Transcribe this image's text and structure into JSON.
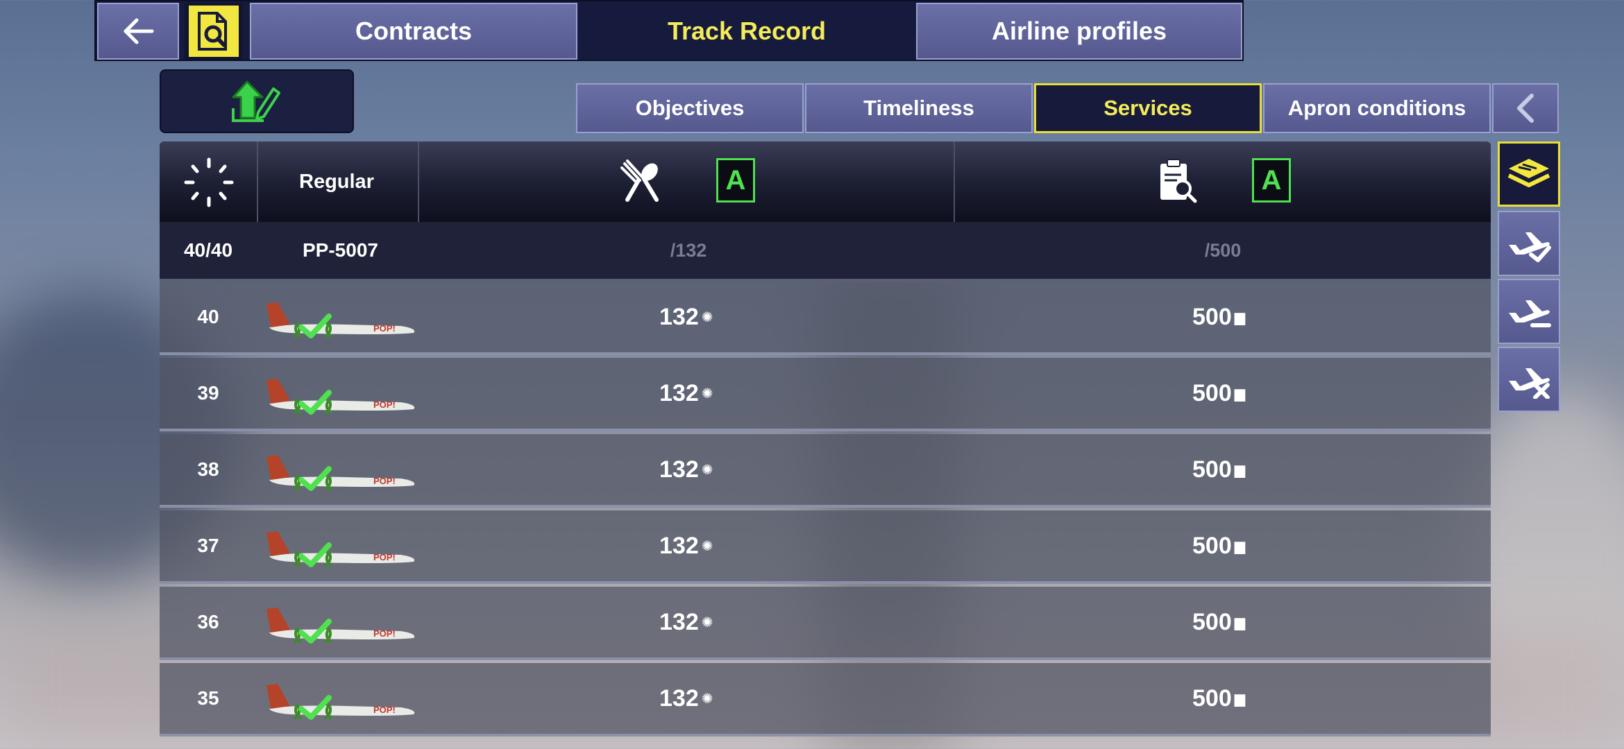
{
  "top_tabs": {
    "contracts": "Contracts",
    "track_record": "Track Record",
    "airline_profiles": "Airline profiles"
  },
  "sub_tabs": {
    "objectives": "Objectives",
    "timeliness": "Timeliness",
    "services": "Services",
    "apron": "Apron conditions"
  },
  "table": {
    "header": {
      "category": "Regular",
      "catering_grade": "A",
      "inspection_grade": "A"
    },
    "summary": {
      "count": "40/40",
      "registration": "PP-5007",
      "catering_max": "/132",
      "inspection_max": "/500"
    },
    "rows": [
      {
        "num": "40",
        "catering": "132",
        "inspection": "500"
      },
      {
        "num": "39",
        "catering": "132",
        "inspection": "500"
      },
      {
        "num": "38",
        "catering": "132",
        "inspection": "500"
      },
      {
        "num": "37",
        "catering": "132",
        "inspection": "500"
      },
      {
        "num": "36",
        "catering": "132",
        "inspection": "500"
      },
      {
        "num": "35",
        "catering": "132",
        "inspection": "500"
      }
    ]
  },
  "icons": {
    "back": "back-arrow-icon",
    "track_record": "document-search-icon",
    "upload": "upload-edit-icon",
    "prev": "chevron-left-icon",
    "loading": "spinner-icon",
    "catering": "fork-spoon-icon",
    "inspection": "clipboard-search-icon",
    "side_filters": [
      "stack-layers-icon",
      "plane-check-icon",
      "plane-minus-icon",
      "plane-x-icon"
    ]
  },
  "colors": {
    "accent_yellow": "#f4ec5a",
    "grade_green": "#4fe14f",
    "tab_blue": "#5f649a",
    "dark_navy": "#161a3d"
  }
}
